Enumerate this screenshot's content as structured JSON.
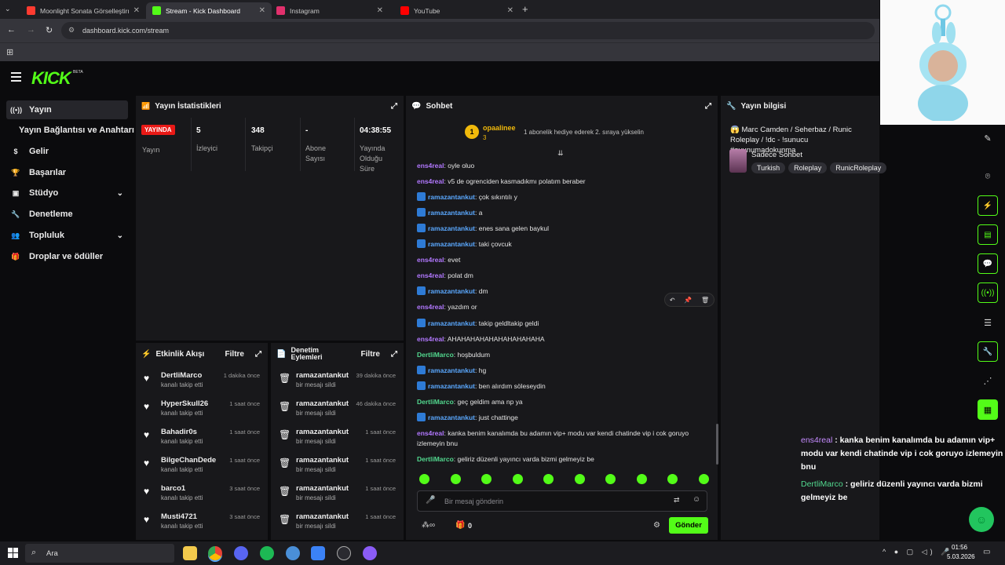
{
  "browser": {
    "tabs": [
      {
        "title": "Moonlight Sonata Görselleştirm",
        "color": "#ff3b30"
      },
      {
        "title": "Stream - Kick Dashboard",
        "color": "#53fc18"
      },
      {
        "title": "Instagram",
        "color": "#e1306c"
      },
      {
        "title": "YouTube",
        "color": "#ff0000"
      }
    ],
    "url": "dashboard.kick.com/stream"
  },
  "site": {
    "logo": "KICK",
    "logo_badge": "BETA"
  },
  "sidebar": {
    "items": [
      {
        "label": "Yayın",
        "icon": "broadcast-icon"
      },
      {
        "label": "Yayın Bağlantısı ve Anahtarı",
        "icon": ""
      },
      {
        "label": "Gelir",
        "icon": "money-icon"
      },
      {
        "label": "Başarılar",
        "icon": "trophy-icon"
      },
      {
        "label": "Stüdyo",
        "icon": "studio-icon"
      },
      {
        "label": "Denetleme",
        "icon": "wrench-icon"
      },
      {
        "label": "Topluluk",
        "icon": "community-icon"
      },
      {
        "label": "Droplar ve ödüller",
        "icon": "gift-icon"
      }
    ]
  },
  "stats": {
    "title": "Yayın İstatistikleri",
    "live_badge": "YAYINDA",
    "live_label": "Yayın",
    "viewers": {
      "value": "5",
      "label": "İzleyici"
    },
    "followers": {
      "value": "348",
      "label": "Takipçi"
    },
    "subs": {
      "value": "-",
      "label": "Abone Sayısı"
    },
    "uptime": {
      "value": "04:38:55",
      "label": "Yayında Olduğu Süre"
    }
  },
  "activity": {
    "title": "Etkinlik Akışı",
    "filter": "Filtre",
    "rows": [
      {
        "name": "DertliMarco",
        "sub": "kanalı takip etti",
        "time": "1 dakika önce"
      },
      {
        "name": "HyperSkull26",
        "sub": "kanalı takip etti",
        "time": "1 saat önce"
      },
      {
        "name": "Bahadir0s",
        "sub": "kanalı takip etti",
        "time": "1 saat önce"
      },
      {
        "name": "BilgeChanDede",
        "sub": "kanalı takip etti",
        "time": "1 saat önce"
      },
      {
        "name": "barco1",
        "sub": "kanalı takip etti",
        "time": "3 saat önce"
      },
      {
        "name": "Musti4721",
        "sub": "kanalı takip etti",
        "time": "3 saat önce"
      }
    ]
  },
  "mod": {
    "title": "Denetim Eylemleri",
    "filter": "Filtre",
    "rows": [
      {
        "name": "ramazantankut",
        "sub": "bir mesajı sildi",
        "time": "39 dakika önce"
      },
      {
        "name": "ramazantankut",
        "sub": "bir mesajı sildi",
        "time": "46 dakika önce"
      },
      {
        "name": "ramazantankut",
        "sub": "bir mesajı sildi",
        "time": "1 saat önce"
      },
      {
        "name": "ramazantankut",
        "sub": "bir mesajı sildi",
        "time": "1 saat önce"
      },
      {
        "name": "ramazantankut",
        "sub": "bir mesajı sildi",
        "time": "1 saat önce"
      },
      {
        "name": "ramazantankut",
        "sub": "bir mesajı sildi",
        "time": "1 saat önce"
      }
    ]
  },
  "chat": {
    "title": "Sohbet",
    "top_gifter": {
      "name": "opaalinee",
      "rank": "1",
      "count": "3"
    },
    "gift_note": "1 abonelik hediye ederek 2. sıraya yükselin",
    "messages": [
      {
        "user": "ens4real",
        "text": "oyle oluo",
        "c": "u1",
        "badge": false
      },
      {
        "user": "ens4real",
        "text": "v5 de ogrenciden kasmadıkmı polatım beraber",
        "c": "u1",
        "badge": false
      },
      {
        "user": "ramazantankut",
        "text": "çok sıkıntılı y",
        "c": "u3",
        "badge": true
      },
      {
        "user": "ramazantankut",
        "text": "a",
        "c": "u3",
        "badge": true
      },
      {
        "user": "ramazantankut",
        "text": "enes sana gelen baykul",
        "c": "u3",
        "badge": true
      },
      {
        "user": "ramazantankut",
        "text": "taki çovcuk",
        "c": "u3",
        "badge": true
      },
      {
        "user": "ens4real",
        "text": "evet",
        "c": "u1",
        "badge": false
      },
      {
        "user": "ens4real",
        "text": "polat dm",
        "c": "u1",
        "badge": false
      },
      {
        "user": "ramazantankut",
        "text": "dm",
        "c": "u3",
        "badge": true
      },
      {
        "user": "ens4real",
        "text": "yazdım or",
        "c": "u1",
        "badge": false
      },
      {
        "user": "ramazantankut",
        "text": "takip geldltakip geldi",
        "c": "u3",
        "badge": true
      },
      {
        "user": "ens4real",
        "text": "AHAHAHAHAHAHAHAHAHAHA",
        "c": "u1",
        "badge": false
      },
      {
        "user": "DertliMarco",
        "text": "hoşbuldum",
        "c": "u2",
        "badge": false
      },
      {
        "user": "ramazantankut",
        "text": "hg",
        "c": "u3",
        "badge": true
      },
      {
        "user": "ramazantankut",
        "text": "ben alırdım söleseydin",
        "c": "u3",
        "badge": true
      },
      {
        "user": "DertliMarco",
        "text": "geç geldim ama np ya",
        "c": "u2",
        "badge": false
      },
      {
        "user": "ramazantankut",
        "text": "just chattinge",
        "c": "u3",
        "badge": true
      },
      {
        "user": "ens4real",
        "text": "kanka benim kanalımda bu adamın vip+ modu var kendi chatinde vip i cok goruyo izlemeyin bnu",
        "c": "u1",
        "badge": false
      },
      {
        "user": "DertliMarco",
        "text": "geliriz düzenli yayıncı varda bizmi gelmeyiz be",
        "c": "u2",
        "badge": false
      }
    ],
    "input_placeholder": "Bir mesaj gönderin",
    "points": "0",
    "send": "Gönder"
  },
  "info": {
    "title": "Yayın bilgisi",
    "stream_title": "😱 Marc Camden / Seherbaz / Runic Roleplay / !dc - !sunucu #oyunumadokunma",
    "category": "Sadece Sohbet",
    "tags": [
      "Turkish",
      "Roleplay",
      "RunicRoleplay"
    ]
  },
  "overlay": {
    "messages": [
      {
        "user": "ens4real",
        "text": "kanka benim kanalımda bu adamın vip+ modu var kendi chatinde vip i cok goruyo izlemeyin bnu"
      },
      {
        "user": "DertliMarco",
        "text": "geliriz düzenli yayıncı varda bizmi gelmeyiz be"
      }
    ]
  },
  "taskbar": {
    "search": "Ara",
    "time": "01:56",
    "date": "5.03.2026"
  },
  "colors": {
    "accent": "#53fc18",
    "live": "#e91916",
    "panel": "#18181b"
  }
}
